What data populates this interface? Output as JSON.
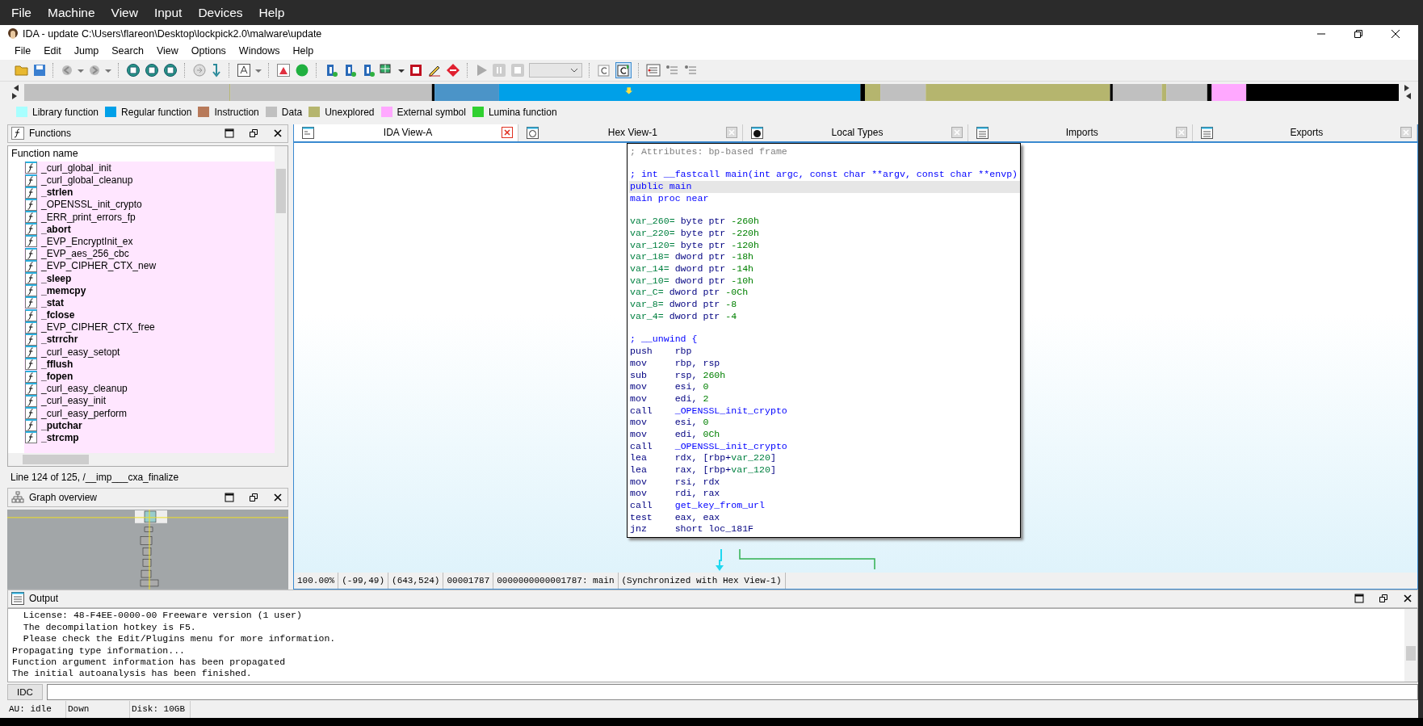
{
  "vm_menu": [
    "File",
    "Machine",
    "View",
    "Input",
    "Devices",
    "Help"
  ],
  "window": {
    "title": "IDA - update C:\\Users\\flareon\\Desktop\\lockpick2.0\\malware\\update"
  },
  "menu": [
    "File",
    "Edit",
    "Jump",
    "Search",
    "View",
    "Options",
    "Windows",
    "Help"
  ],
  "legend": [
    {
      "label": "Library function",
      "color": "#a8ffff"
    },
    {
      "label": "Regular function",
      "color": "#00a0e8"
    },
    {
      "label": "Instruction",
      "color": "#b87a5a"
    },
    {
      "label": "Data",
      "color": "#c0c0c0"
    },
    {
      "label": "Unexplored",
      "color": "#b5b56e"
    },
    {
      "label": "External symbol",
      "color": "#ffa8ff"
    },
    {
      "label": "Lumina function",
      "color": "#30d030"
    }
  ],
  "functions_panel": {
    "title": "Functions",
    "column": "Function name",
    "items": [
      {
        "name": "_curl_global_init",
        "bold": false
      },
      {
        "name": "_curl_global_cleanup",
        "bold": false
      },
      {
        "name": "_strlen",
        "bold": true
      },
      {
        "name": "_OPENSSL_init_crypto",
        "bold": false
      },
      {
        "name": "_ERR_print_errors_fp",
        "bold": false
      },
      {
        "name": "_abort",
        "bold": true
      },
      {
        "name": "_EVP_EncryptInit_ex",
        "bold": false
      },
      {
        "name": "_EVP_aes_256_cbc",
        "bold": false
      },
      {
        "name": "_EVP_CIPHER_CTX_new",
        "bold": false
      },
      {
        "name": "_sleep",
        "bold": true
      },
      {
        "name": "_memcpy",
        "bold": true
      },
      {
        "name": "_stat",
        "bold": true
      },
      {
        "name": "_fclose",
        "bold": true
      },
      {
        "name": "_EVP_CIPHER_CTX_free",
        "bold": false
      },
      {
        "name": "_strrchr",
        "bold": true
      },
      {
        "name": "_curl_easy_setopt",
        "bold": false
      },
      {
        "name": "_fflush",
        "bold": true
      },
      {
        "name": "_fopen",
        "bold": true
      },
      {
        "name": "_curl_easy_cleanup",
        "bold": false
      },
      {
        "name": "_curl_easy_init",
        "bold": false
      },
      {
        "name": "_curl_easy_perform",
        "bold": false
      },
      {
        "name": "_putchar",
        "bold": true
      },
      {
        "name": "_strcmp",
        "bold": true
      }
    ],
    "footer": "Line 124 of 125, /__imp___cxa_finalize"
  },
  "graph_overview": {
    "title": "Graph overview"
  },
  "tabs": [
    {
      "label": "IDA View-A",
      "selected": true
    },
    {
      "label": "Hex View-1",
      "selected": false
    },
    {
      "label": "Local Types",
      "selected": false
    },
    {
      "label": "Imports",
      "selected": false
    },
    {
      "label": "Exports",
      "selected": false
    }
  ],
  "disassembly": {
    "blocks": [
      {
        "lines": [
          {
            "selected": false,
            "parts": [
              {
                "text": "; Attributes: bp-based frame",
                "kind": "comment"
              }
            ]
          }
        ]
      },
      {
        "lines": [
          {
            "selected": false,
            "parts": [
              {
                "text": "; int __fastcall main(int argc, const char **argv, const char **envp)",
                "kind": "name"
              }
            ]
          },
          {
            "selected": true,
            "parts": [
              {
                "text": "public main",
                "kind": "name"
              }
            ]
          },
          {
            "selected": false,
            "parts": [
              {
                "text": "main proc near",
                "kind": "name"
              }
            ]
          }
        ]
      },
      {
        "lines": [
          {
            "selected": false,
            "parts": [
              {
                "text": "var_260=",
                "kind": "var"
              },
              {
                "text": " byte ptr ",
                "kind": "code"
              },
              {
                "text": "-260h",
                "kind": "number"
              }
            ]
          },
          {
            "selected": false,
            "parts": [
              {
                "text": "var_220=",
                "kind": "var"
              },
              {
                "text": " byte ptr ",
                "kind": "code"
              },
              {
                "text": "-220h",
                "kind": "number"
              }
            ]
          },
          {
            "selected": false,
            "parts": [
              {
                "text": "var_120=",
                "kind": "var"
              },
              {
                "text": " byte ptr ",
                "kind": "code"
              },
              {
                "text": "-120h",
                "kind": "number"
              }
            ]
          },
          {
            "selected": false,
            "parts": [
              {
                "text": "var_18=",
                "kind": "var"
              },
              {
                "text": " dword ptr ",
                "kind": "code"
              },
              {
                "text": "-18h",
                "kind": "number"
              }
            ]
          },
          {
            "selected": false,
            "parts": [
              {
                "text": "var_14=",
                "kind": "var"
              },
              {
                "text": " dword ptr ",
                "kind": "code"
              },
              {
                "text": "-14h",
                "kind": "number"
              }
            ]
          },
          {
            "selected": false,
            "parts": [
              {
                "text": "var_10=",
                "kind": "var"
              },
              {
                "text": " dword ptr ",
                "kind": "code"
              },
              {
                "text": "-10h",
                "kind": "number"
              }
            ]
          },
          {
            "selected": false,
            "parts": [
              {
                "text": "var_C=",
                "kind": "var"
              },
              {
                "text": " dword ptr ",
                "kind": "code"
              },
              {
                "text": "-0Ch",
                "kind": "number"
              }
            ]
          },
          {
            "selected": false,
            "parts": [
              {
                "text": "var_8=",
                "kind": "var"
              },
              {
                "text": " dword ptr ",
                "kind": "code"
              },
              {
                "text": "-8",
                "kind": "number"
              }
            ]
          },
          {
            "selected": false,
            "parts": [
              {
                "text": "var_4=",
                "kind": "var"
              },
              {
                "text": " dword ptr ",
                "kind": "code"
              },
              {
                "text": "-4",
                "kind": "number"
              }
            ]
          }
        ]
      },
      {
        "lines": [
          {
            "selected": false,
            "parts": [
              {
                "text": "; __unwind {",
                "kind": "name"
              }
            ]
          },
          {
            "selected": false,
            "parts": [
              {
                "text": "push    rbp",
                "kind": "code"
              }
            ]
          },
          {
            "selected": false,
            "parts": [
              {
                "text": "mov     rbp, rsp",
                "kind": "code"
              }
            ]
          },
          {
            "selected": false,
            "parts": [
              {
                "text": "sub     rsp, ",
                "kind": "code"
              },
              {
                "text": "260h",
                "kind": "number"
              }
            ]
          },
          {
            "selected": false,
            "parts": [
              {
                "text": "mov     esi, ",
                "kind": "code"
              },
              {
                "text": "0",
                "kind": "number"
              }
            ]
          },
          {
            "selected": false,
            "parts": [
              {
                "text": "mov     edi, ",
                "kind": "code"
              },
              {
                "text": "2",
                "kind": "number"
              }
            ]
          },
          {
            "selected": false,
            "parts": [
              {
                "text": "call    ",
                "kind": "code"
              },
              {
                "text": "_OPENSSL_init_crypto",
                "kind": "name"
              }
            ]
          },
          {
            "selected": false,
            "parts": [
              {
                "text": "mov     esi, ",
                "kind": "code"
              },
              {
                "text": "0",
                "kind": "number"
              }
            ]
          },
          {
            "selected": false,
            "parts": [
              {
                "text": "mov     edi, ",
                "kind": "code"
              },
              {
                "text": "0Ch",
                "kind": "number"
              }
            ]
          },
          {
            "selected": false,
            "parts": [
              {
                "text": "call    ",
                "kind": "code"
              },
              {
                "text": "_OPENSSL_init_crypto",
                "kind": "name"
              }
            ]
          },
          {
            "selected": false,
            "parts": [
              {
                "text": "lea     rdx, [rbp+",
                "kind": "code"
              },
              {
                "text": "var_220",
                "kind": "var"
              },
              {
                "text": "]",
                "kind": "code"
              }
            ]
          },
          {
            "selected": false,
            "parts": [
              {
                "text": "lea     rax, [rbp+",
                "kind": "code"
              },
              {
                "text": "var_120",
                "kind": "var"
              },
              {
                "text": "]",
                "kind": "code"
              }
            ]
          },
          {
            "selected": false,
            "parts": [
              {
                "text": "mov     rsi, rdx",
                "kind": "code"
              }
            ]
          },
          {
            "selected": false,
            "parts": [
              {
                "text": "mov     rdi, rax",
                "kind": "code"
              }
            ]
          },
          {
            "selected": false,
            "parts": [
              {
                "text": "call    ",
                "kind": "code"
              },
              {
                "text": "get_key_from_url",
                "kind": "name"
              }
            ]
          },
          {
            "selected": false,
            "parts": [
              {
                "text": "test    eax, eax",
                "kind": "code"
              }
            ]
          },
          {
            "selected": false,
            "parts": [
              {
                "text": "jnz     short loc_181F",
                "kind": "code"
              }
            ]
          }
        ]
      }
    ]
  },
  "view_status": [
    "100.00%",
    "(-99,49)",
    "(643,524)",
    "00001787",
    "0000000000001787: main",
    "(Synchronized with Hex View-1)"
  ],
  "output": {
    "title": "Output",
    "lines": [
      "  License: 48-F4EE-0000-00 Freeware version (1 user)",
      "  The decompilation hotkey is F5.",
      "  Please check the Edit/Plugins menu for more information.",
      "Propagating type information...",
      "Function argument information has been propagated",
      "The initial autoanalysis has been finished."
    ]
  },
  "command": {
    "button": "IDC"
  },
  "status_bar": [
    "AU:  idle",
    "Down",
    "Disk: 10GB"
  ]
}
